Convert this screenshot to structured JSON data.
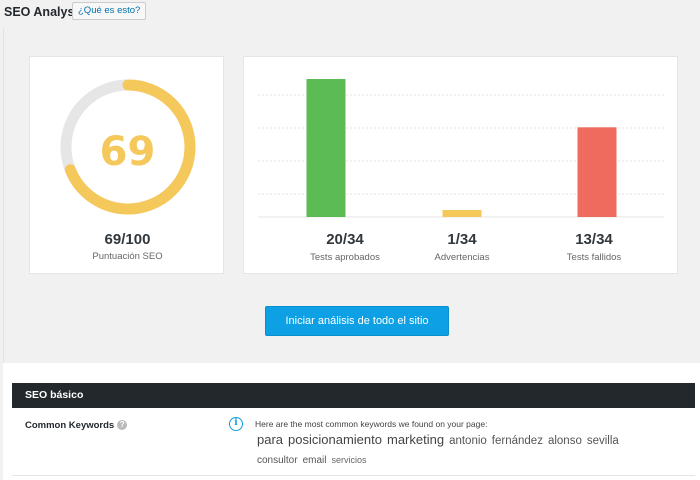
{
  "header": {
    "title": "SEO Analysis",
    "help_link": "¿Qué es esto?"
  },
  "score": {
    "value": "69",
    "total": "69/100",
    "label": "Puntuación SEO",
    "fraction": 0.69,
    "color": "#f5c85c",
    "track_color": "#e6e6e6"
  },
  "results": {
    "passed": {
      "value": "20/34",
      "label": "Tests aprobados",
      "count": 20,
      "color": "#5cbb55"
    },
    "warnings": {
      "value": "1/34",
      "label": "Advertencias",
      "count": 1,
      "color": "#f5c85c"
    },
    "failed": {
      "value": "13/34",
      "label": "Tests fallidos",
      "count": 13,
      "color": "#ee6b5e"
    },
    "total": 34
  },
  "chart_data": {
    "type": "bar",
    "categories": [
      "Tests aprobados",
      "Advertencias",
      "Tests fallidos"
    ],
    "values": [
      20,
      1,
      13
    ],
    "ylim": [
      0,
      20
    ],
    "grid": true
  },
  "actions": {
    "analyze_button": "Iniciar análisis de todo el sitio"
  },
  "section": {
    "title": "SEO básico"
  },
  "common_keywords": {
    "label": "Common Keywords",
    "description": "Here are the most common keywords we found on your page:",
    "keywords": [
      {
        "text": "para",
        "level": 5
      },
      {
        "text": "posicionamiento",
        "level": 5
      },
      {
        "text": "marketing",
        "level": 5
      },
      {
        "text": "antonio",
        "level": 3
      },
      {
        "text": "fernández",
        "level": 3
      },
      {
        "text": "alonso",
        "level": 3
      },
      {
        "text": "sevilla",
        "level": 3
      },
      {
        "text": "consultor",
        "level": 2
      },
      {
        "text": "email",
        "level": 2
      },
      {
        "text": "servicios",
        "level": 1
      }
    ]
  }
}
